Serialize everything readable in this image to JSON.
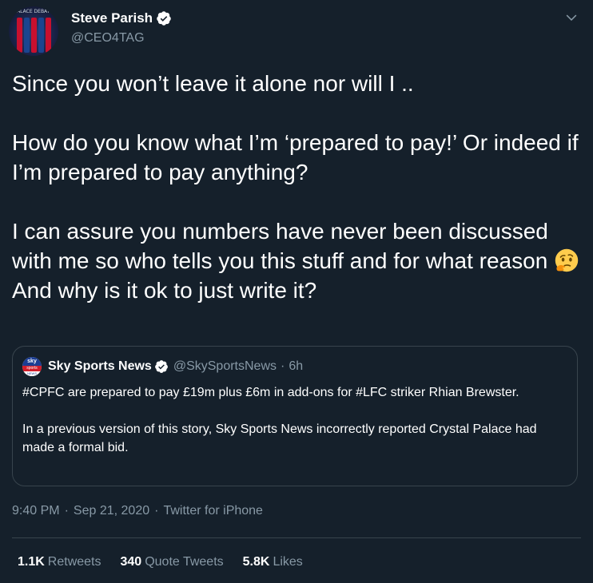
{
  "author": {
    "name": "Steve Parish",
    "handle": "@CEO4TAG",
    "avatar_caption": "PALACE DEBATE"
  },
  "tweet": {
    "line1": "Since you won’t leave it alone nor will I ..",
    "line2": "How do you know what I’m ‘prepared to pay!’ Or indeed if I’m prepared to pay anything?",
    "line3": "I can assure you numbers have never been discussed with me so who tells you this stuff and for what reason",
    "emoji": "thinking-face",
    "line4": "And why is it ok to just write it?"
  },
  "quote": {
    "name": "Sky Sports News",
    "handle": "@SkySportsNews",
    "dot": "·",
    "time": "6h",
    "avatar_text_top": "sky",
    "avatar_text_mid": "sports",
    "avatar_text_bot": "NEWS",
    "para1": "#CPFC are prepared to pay £19m plus £6m in add-ons for #LFC striker Rhian Brewster.",
    "para2": "In a previous version of this story, Sky Sports News incorrectly reported Crystal Palace had made a formal bid."
  },
  "meta": {
    "time": "9:40 PM",
    "sep": "·",
    "date": "Sep 21, 2020",
    "source": "Twitter for iPhone"
  },
  "stats": {
    "retweets_count": "1.1K",
    "retweets_label": "Retweets",
    "quotes_count": "340",
    "quotes_label": "Quote Tweets",
    "likes_count": "5.8K",
    "likes_label": "Likes"
  },
  "colors": {
    "background": "#15202b",
    "text": "#ffffff",
    "secondary": "#8899a6",
    "border": "#38444d",
    "verified": "#ffffff"
  }
}
